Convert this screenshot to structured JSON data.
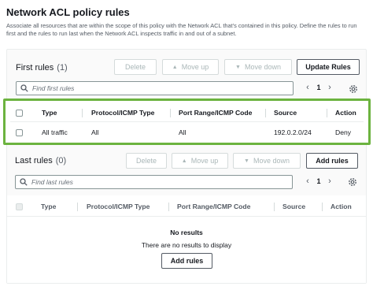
{
  "header": {
    "title": "Network ACL policy rules",
    "description": "Associate all resources that are within the scope of this policy with the Network ACL that's contained in this policy. Define the rules to run first and the rules to run last when the Network ACL inspects traffic in and out of a subnet."
  },
  "first_rules": {
    "title": "First rules",
    "count": "(1)",
    "delete_label": "Delete",
    "move_up_label": "Move up",
    "move_down_label": "Move down",
    "update_label": "Update Rules",
    "search_placeholder": "Find first rules",
    "page": "1",
    "columns": [
      "Type",
      "Protocol/ICMP Type",
      "Port Range/ICMP Code",
      "Source",
      "Action"
    ],
    "rows": [
      {
        "type": "All traffic",
        "protocol": "All",
        "port_range": "All",
        "source": "192.0.2.0/24",
        "action": "Deny"
      }
    ]
  },
  "last_rules": {
    "title": "Last rules",
    "count": "(0)",
    "delete_label": "Delete",
    "move_up_label": "Move up",
    "move_down_label": "Move down",
    "add_label": "Add rules",
    "search_placeholder": "Find last rules",
    "page": "1",
    "columns": [
      "Type",
      "Protocol/ICMP Type",
      "Port Range/ICMP Code",
      "Source",
      "Action"
    ],
    "empty_title": "No results",
    "empty_text": "There are no results to display",
    "empty_button": "Add rules"
  },
  "colors": {
    "highlight": "#6cb33f",
    "border": "#eaeded",
    "text": "#16191f",
    "muted": "#545b64",
    "disabled": "#aab7b8"
  }
}
